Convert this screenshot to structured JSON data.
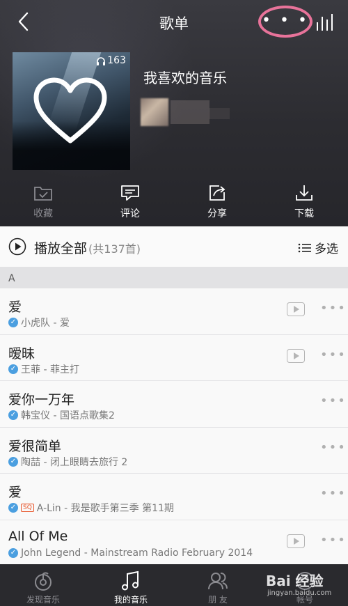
{
  "nav": {
    "title": "歌单",
    "more_dots": "• • •"
  },
  "playlist": {
    "name": "我喜欢的音乐",
    "play_count": "163"
  },
  "actions": [
    {
      "label": "收藏",
      "icon": "folder-check-icon",
      "enabled": false
    },
    {
      "label": "评论",
      "icon": "comment-icon",
      "enabled": true
    },
    {
      "label": "分享",
      "icon": "share-icon",
      "enabled": true
    },
    {
      "label": "下载",
      "icon": "download-icon",
      "enabled": true
    }
  ],
  "play_all": {
    "label": "播放全部",
    "count": "(共137首)",
    "multi_select": "多选"
  },
  "section": "A",
  "songs": [
    {
      "title": "爱",
      "subtitle": "小虎队 - 爱",
      "has_mv": true,
      "sq": ""
    },
    {
      "title": "暧昧",
      "subtitle": "王菲 - 菲主打",
      "has_mv": true,
      "sq": ""
    },
    {
      "title": "爱你一万年",
      "subtitle": "韩宝仪 - 国语点歌集2",
      "has_mv": false,
      "sq": ""
    },
    {
      "title": "爱很简单",
      "subtitle": "陶喆 - 闭上眼睛去旅行 2",
      "has_mv": false,
      "sq": ""
    },
    {
      "title": "爱",
      "subtitle": "A-Lin - 我是歌手第三季 第11期",
      "has_mv": false,
      "sq": "SQ"
    },
    {
      "title": "All Of Me",
      "subtitle": "John Legend - Mainstream Radio February 2014",
      "has_mv": true,
      "sq": ""
    }
  ],
  "tabs": [
    {
      "label": "发现音乐",
      "icon": "discover-music-icon"
    },
    {
      "label": "我的音乐",
      "icon": "my-music-icon"
    },
    {
      "label": "朋 友",
      "icon": "friends-icon"
    },
    {
      "label": "帐号",
      "icon": "account-icon"
    }
  ],
  "watermark": {
    "brand": "Bai 经验",
    "url": "jingyan.baidu.com"
  },
  "colors": {
    "accent_ring": "#e8739a",
    "check_blue": "#4b9fe0",
    "header_bg": "#2c2c31",
    "tabbar_bg": "#2a2a2e"
  }
}
